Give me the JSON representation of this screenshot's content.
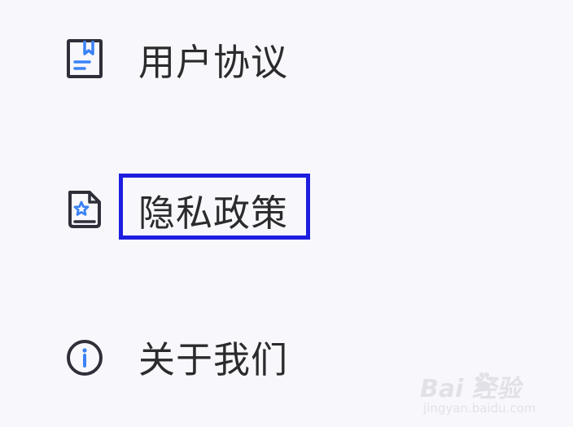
{
  "menu": {
    "items": [
      {
        "label": "用户协议",
        "icon": "document-bookmark-icon"
      },
      {
        "label": "隐私政策",
        "icon": "privacy-star-document-icon"
      },
      {
        "label": "关于我们",
        "icon": "info-circle-icon"
      }
    ]
  },
  "watermark": {
    "brand": "Bai  经验",
    "url": "jingyan.baidu.com"
  },
  "colors": {
    "background": "#f8f8fc",
    "icon_dark": "#2f2f3a",
    "icon_accent": "#3b82f6",
    "highlight_border": "#1e1ee0",
    "text": "#2b2b2d"
  }
}
